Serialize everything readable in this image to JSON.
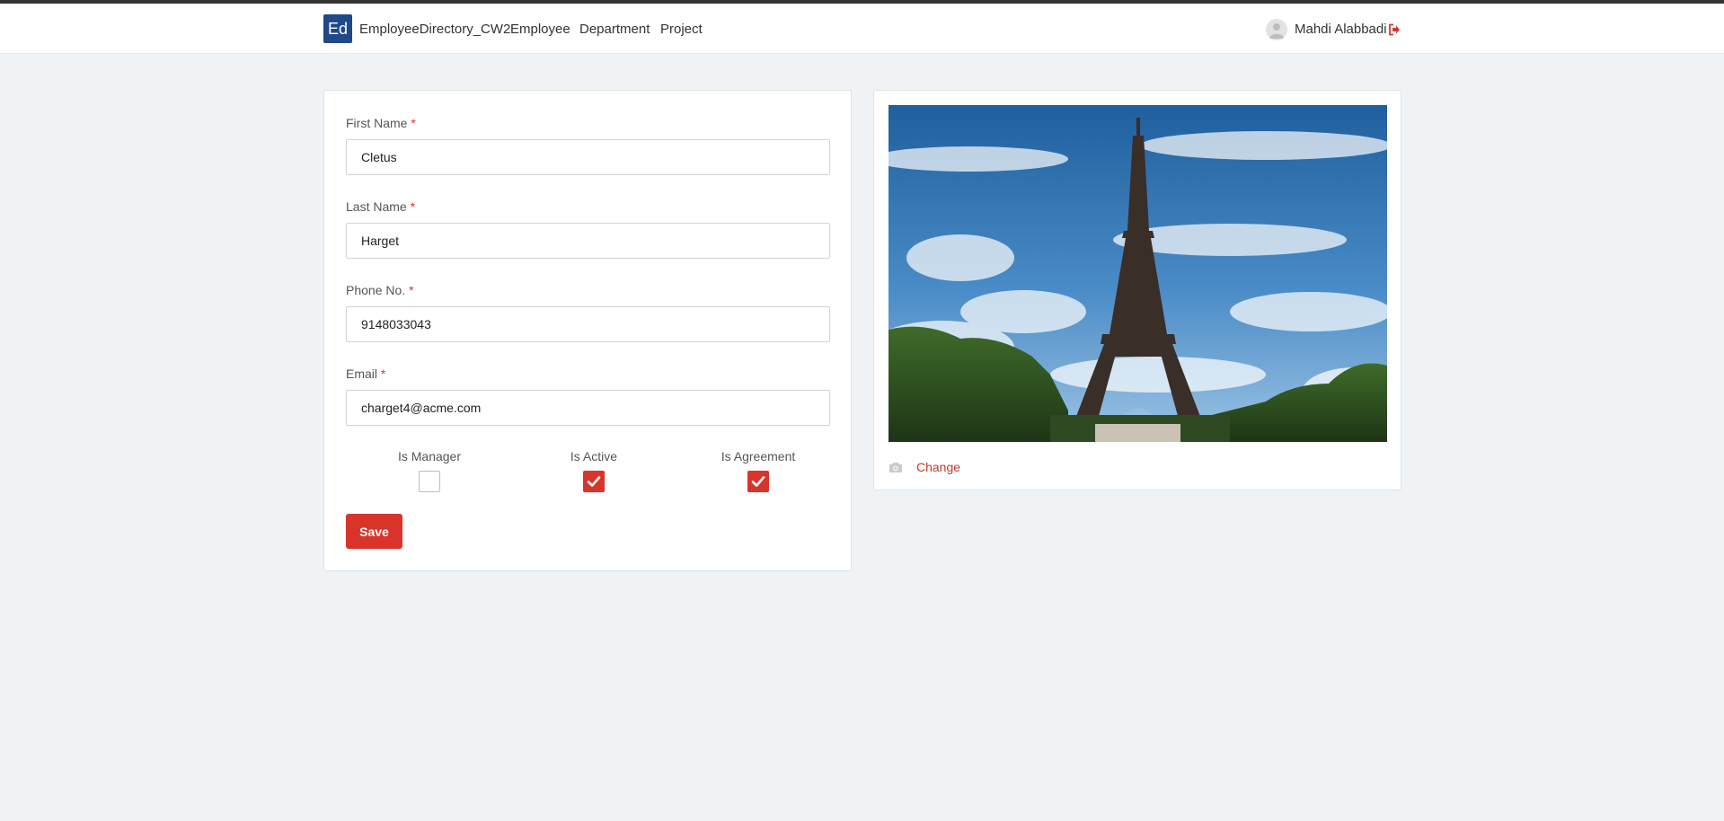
{
  "navbar": {
    "brand_abbr": "Ed",
    "brand_name": "EmployeeDirectory_CW2",
    "links": [
      "Employee",
      "Department",
      "Project"
    ],
    "user_name": "Mahdi Alabbadi",
    "icons": {
      "avatar": "user-avatar-icon",
      "logout": "sign-out-icon"
    }
  },
  "form": {
    "first_name": {
      "label": "First Name",
      "required_mark": "*",
      "value": "Cletus"
    },
    "last_name": {
      "label": "Last Name",
      "required_mark": "*",
      "value": "Harget"
    },
    "phone": {
      "label": "Phone No.",
      "required_mark": "*",
      "value": "9148033043"
    },
    "email": {
      "label": "Email",
      "required_mark": "*",
      "value": "charget4@acme.com"
    },
    "checkboxes": [
      {
        "label": "Is Manager",
        "checked": false
      },
      {
        "label": "Is Active",
        "checked": true
      },
      {
        "label": "Is Agreement",
        "checked": true
      }
    ],
    "save_label": "Save"
  },
  "photo": {
    "change_label": "Change",
    "icons": {
      "camera": "camera-icon"
    }
  },
  "colors": {
    "accent": "#d9342b",
    "brand": "#1f4a87",
    "background": "#f0f3f6"
  }
}
